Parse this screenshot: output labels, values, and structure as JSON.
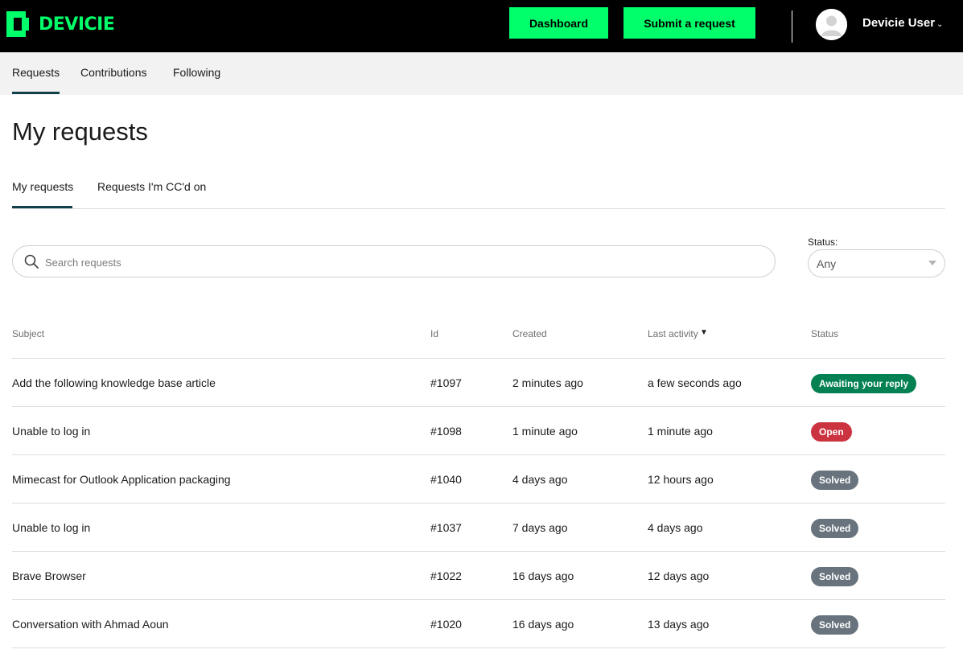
{
  "header": {
    "brand": "DEVICIE",
    "dashboard_label": "Dashboard",
    "submit_label": "Submit a request",
    "user_name": "Devicie User",
    "accent_color": "#00ff6a"
  },
  "subnav": {
    "items": [
      {
        "label": "Requests",
        "active": true
      },
      {
        "label": "Contributions",
        "active": false
      },
      {
        "label": "Following",
        "active": false
      }
    ]
  },
  "page": {
    "title": "My requests",
    "tabs": [
      {
        "label": "My requests",
        "active": true
      },
      {
        "label": "Requests I'm CC'd on",
        "active": false
      }
    ]
  },
  "filters": {
    "search_placeholder": "Search requests",
    "search_value": "",
    "status_label": "Status:",
    "status_value": "Any"
  },
  "table": {
    "headers": {
      "subject": "Subject",
      "id": "Id",
      "created": "Created",
      "last_activity": "Last activity",
      "status": "Status"
    },
    "rows": [
      {
        "subject": "Add the following knowledge base article",
        "id": "#1097",
        "created": "2 minutes ago",
        "last_activity": "a few seconds ago",
        "status": "Awaiting your reply",
        "status_color": "#038153"
      },
      {
        "subject": "Unable to log in",
        "id": "#1098",
        "created": "1 minute ago",
        "last_activity": "1 minute ago",
        "status": "Open",
        "status_color": "#cc3340"
      },
      {
        "subject": "Mimecast for Outlook Application packaging",
        "id": "#1040",
        "created": "4 days ago",
        "last_activity": "12 hours ago",
        "status": "Solved",
        "status_color": "#68737d"
      },
      {
        "subject": "Unable to log in",
        "id": "#1037",
        "created": "7 days ago",
        "last_activity": "4 days ago",
        "status": "Solved",
        "status_color": "#68737d"
      },
      {
        "subject": "Brave Browser",
        "id": "#1022",
        "created": "16 days ago",
        "last_activity": "12 days ago",
        "status": "Solved",
        "status_color": "#68737d"
      },
      {
        "subject": "Conversation with Ahmad Aoun",
        "id": "#1020",
        "created": "16 days ago",
        "last_activity": "13 days ago",
        "status": "Solved",
        "status_color": "#68737d"
      }
    ]
  }
}
